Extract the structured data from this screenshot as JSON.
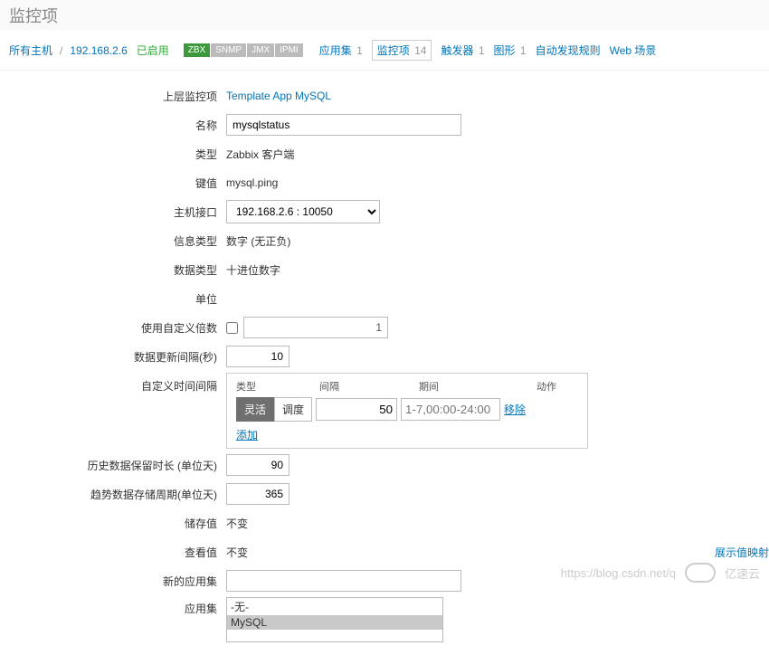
{
  "page": {
    "title": "监控项"
  },
  "breadcrumb": {
    "all_hosts": "所有主机",
    "host_ip": "192.168.2.6",
    "enabled": "已启用",
    "badges": {
      "zbx": "ZBX",
      "snmp": "SNMP",
      "jmx": "JMX",
      "ipmi": "IPMI"
    }
  },
  "tabs": {
    "apps": {
      "label": "应用集",
      "count": "1"
    },
    "items": {
      "label": "监控项",
      "count": "14"
    },
    "triggers": {
      "label": "触发器",
      "count": "1"
    },
    "graphs": {
      "label": "图形",
      "count": "1"
    },
    "discovery": {
      "label": "自动发现规则"
    },
    "web": {
      "label": "Web 场景"
    }
  },
  "form": {
    "parent": {
      "label": "上层监控项",
      "value": "Template App MySQL"
    },
    "name": {
      "label": "名称",
      "value": "mysqlstatus"
    },
    "type": {
      "label": "类型",
      "value": "Zabbix 客户端"
    },
    "key": {
      "label": "键值",
      "value": "mysql.ping"
    },
    "iface": {
      "label": "主机接口",
      "value": "192.168.2.6 : 10050"
    },
    "info_type": {
      "label": "信息类型",
      "value": "数字 (无正负)"
    },
    "data_type": {
      "label": "数据类型",
      "value": "十进位数字"
    },
    "units": {
      "label": "单位",
      "value": ""
    },
    "multiplier": {
      "label": "使用自定义倍数",
      "value": "1"
    },
    "interval": {
      "label": "数据更新间隔(秒)",
      "value": "10"
    },
    "custom_int": {
      "label": "自定义时间间隔",
      "head": {
        "type": "类型",
        "interval": "间隔",
        "period": "期间",
        "action": "动作"
      },
      "seg": {
        "flex": "灵活",
        "sched": "调度"
      },
      "int_val": "50",
      "period_ph": "1-7,00:00-24:00",
      "remove": "移除",
      "add": "添加"
    },
    "history": {
      "label": "历史数据保留时长 (单位天)",
      "value": "90"
    },
    "trends": {
      "label": "趋势数据存储周期(单位天)",
      "value": "365"
    },
    "store": {
      "label": "储存值",
      "value": "不变"
    },
    "show": {
      "label": "查看值",
      "value": "不变",
      "link": "展示值映射"
    },
    "newapp": {
      "label": "新的应用集",
      "value": ""
    },
    "apps": {
      "label": "应用集",
      "none": "-无-",
      "mysql": "MySQL"
    }
  },
  "watermark": {
    "url": "https://blog.csdn.net/q",
    "brand": "亿速云"
  }
}
